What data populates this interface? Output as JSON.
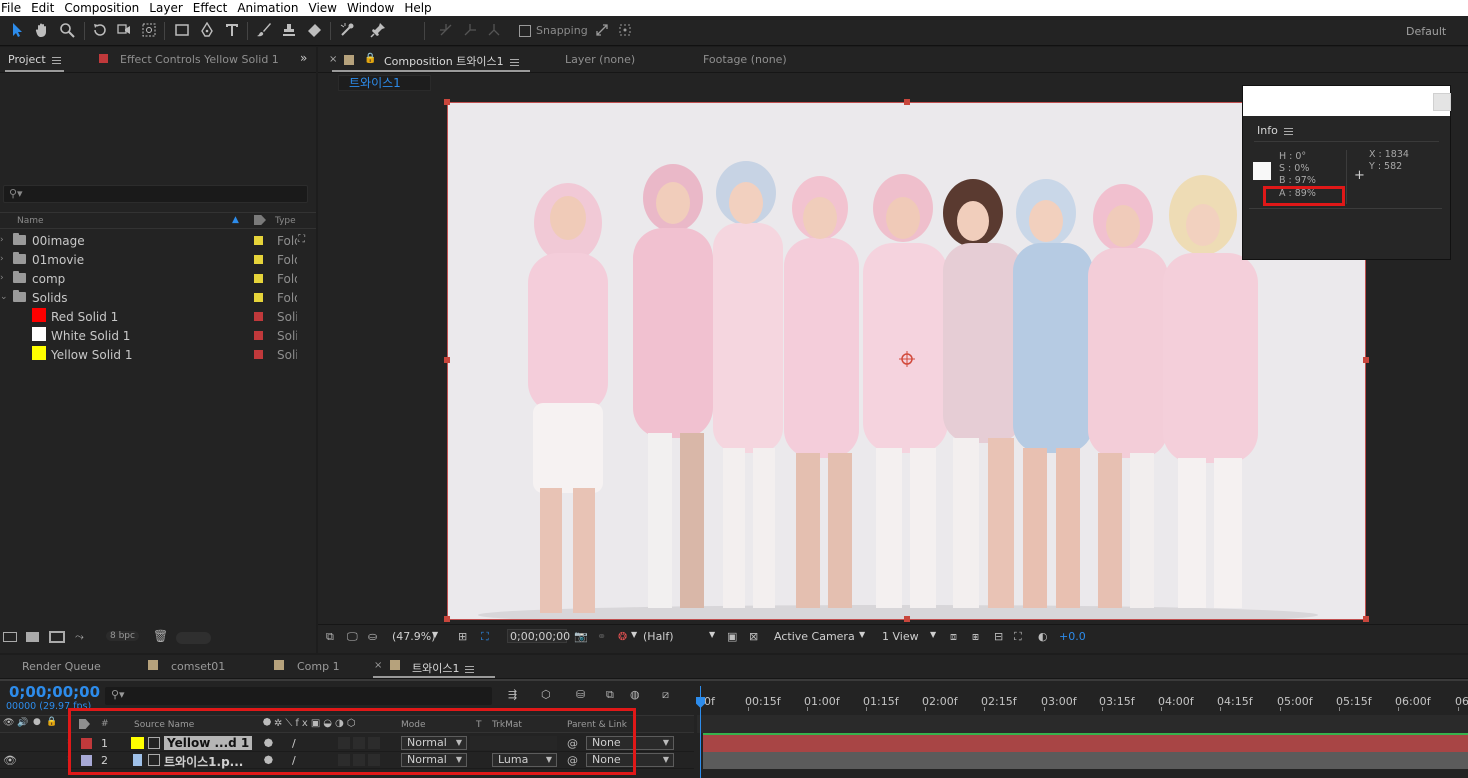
{
  "menu": [
    "File",
    "Edit",
    "Composition",
    "Layer",
    "Effect",
    "Animation",
    "View",
    "Window",
    "Help"
  ],
  "toolbar": {
    "snapping_label": "Snapping",
    "workspace": "Default"
  },
  "project_panel": {
    "tab_project": "Project",
    "tab_effect_controls": "Effect Controls Yellow Solid 1",
    "col_name": "Name",
    "col_type": "Type",
    "items": [
      {
        "name": "00image",
        "type": "Folder",
        "label_color": "#e6d43a",
        "kind": "folder",
        "indent": 0
      },
      {
        "name": "01movie",
        "type": "Folder",
        "label_color": "#e6d43a",
        "kind": "folder",
        "indent": 0
      },
      {
        "name": "comp",
        "type": "Folder",
        "label_color": "#e6d43a",
        "kind": "folder",
        "indent": 0
      },
      {
        "name": "Solids",
        "type": "Folder",
        "label_color": "#e6d43a",
        "kind": "folder",
        "indent": 0
      },
      {
        "name": "Red Solid 1",
        "type": "Solid",
        "label_color": "#c0393b",
        "kind": "solid",
        "swatch": "#ff0000",
        "indent": 1
      },
      {
        "name": "White Solid 1",
        "type": "Solid",
        "label_color": "#c0393b",
        "kind": "solid",
        "swatch": "#ffffff",
        "indent": 1
      },
      {
        "name": "Yellow Solid 1",
        "type": "Solid",
        "label_color": "#c0393b",
        "kind": "solid",
        "swatch": "#ffff00",
        "indent": 1
      }
    ],
    "bpc": "8 bpc"
  },
  "comp_panel": {
    "tab_composition": "Composition 트와이스1",
    "tab_layer": "Layer (none)",
    "tab_footage": "Footage (none)",
    "sub_tab": "트와이스1",
    "zoom": "(47.9%)",
    "timecode": "0;00;00;00",
    "resolution": "(Half)",
    "camera": "Active Camera",
    "views": "1 View",
    "exposure": "+0.0"
  },
  "info_panel": {
    "title": "Info",
    "h": "H :  0°",
    "s": "S :  0%",
    "b": "B :  97%",
    "a": "A :  89%",
    "x": "X : 1834",
    "y": "Y : 582"
  },
  "timeline": {
    "tab_render_queue": "Render Queue",
    "tab_comset": "comset01",
    "tab_comp1": "Comp 1",
    "tab_active": "트와이스1",
    "timecode": "0;00;00;00",
    "fps": "00000 (29.97 fps)",
    "ruler": [
      "00f",
      "00:15f",
      "01:00f",
      "01:15f",
      "02:00f",
      "02:15f",
      "03:00f",
      "03:15f",
      "04:00f",
      "04:15f",
      "05:00f",
      "05:15f",
      "06:00f",
      "06"
    ],
    "col_num": "#",
    "col_source": "Source Name",
    "col_mode": "Mode",
    "col_t": "T",
    "col_trkmat": "TrkMat",
    "col_parent": "Parent & Link",
    "layers": [
      {
        "num": "1",
        "name": "Yellow ...d 1",
        "mode": "Normal",
        "trkmat": "",
        "parent": "None",
        "label_color": "#c0393b",
        "swatch": "#ffff00"
      },
      {
        "num": "2",
        "name": "트와이스1.p...",
        "mode": "Normal",
        "trkmat": "Luma",
        "parent": "None",
        "label_color": "#a7a9d6",
        "swatch": ""
      }
    ]
  },
  "colors": {
    "accent_blue": "#2d8ceb",
    "highlight_red": "#e01818",
    "track_red": "#a84545",
    "track_gray": "#5b5b5b"
  }
}
